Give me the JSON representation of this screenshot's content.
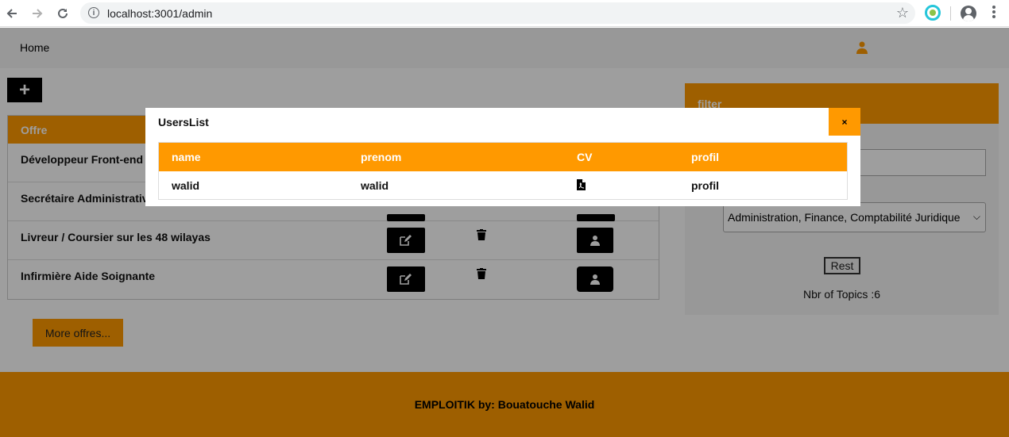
{
  "browser": {
    "url": "localhost:3001/admin"
  },
  "navbar": {
    "home_label": "Home"
  },
  "add_button_label": "+",
  "offres": {
    "header": "Offre",
    "rows": [
      {
        "title": "Développeur Front-end"
      },
      {
        "title": "Secrétaire Administrativ"
      },
      {
        "title": "Livreur / Coursier sur les 48 wilayas"
      },
      {
        "title": "Infirmière Aide Soignante"
      }
    ]
  },
  "more_button_label": "More offres...",
  "filter": {
    "header": "filter",
    "select_value": "Administration, Finance, Comptabilité Juridique",
    "reset_label": "Rest",
    "topics_text": "Nbr of Topics :6"
  },
  "footer_text": "EMPLOITIK by: Bouatouche Walid",
  "modal": {
    "title": "UsersList",
    "close_label": "×",
    "columns": [
      "name",
      "prenom",
      "CV",
      "profil"
    ],
    "rows": [
      {
        "name": "walid",
        "prenom": "walid",
        "profil": "profil"
      }
    ]
  },
  "colors": {
    "accent": "#ff9900",
    "dark": "#000000"
  }
}
